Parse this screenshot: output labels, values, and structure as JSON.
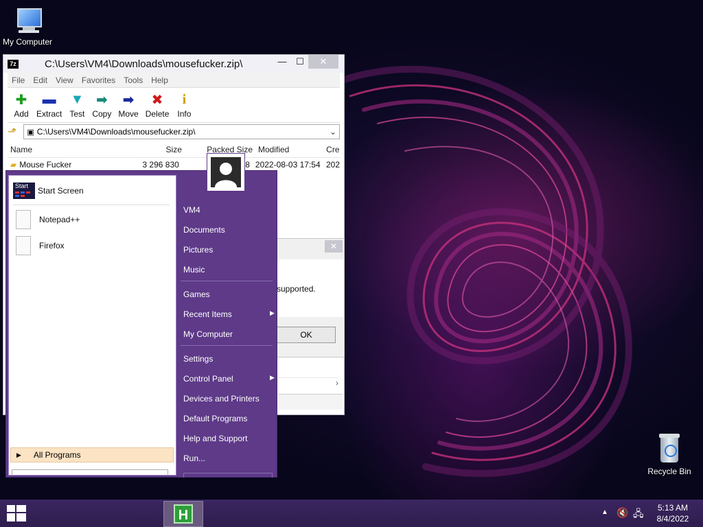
{
  "desktop": {
    "my_computer_label": "My Computer",
    "recycle_bin_label": "Recycle Bin"
  },
  "sevenzip": {
    "app_icon_text": "7z",
    "title": "C:\\Users\\VM4\\Downloads\\mousefucker.zip\\",
    "menu": [
      "File",
      "Edit",
      "View",
      "Favorites",
      "Tools",
      "Help"
    ],
    "toolbar": [
      {
        "label": "Add",
        "icon": "plus-icon",
        "color": "#1a9e1a",
        "glyph": "✚"
      },
      {
        "label": "Extract",
        "icon": "minus-icon",
        "color": "#1a30b0",
        "glyph": "▬"
      },
      {
        "label": "Test",
        "icon": "check-chevron-icon",
        "color": "#1aa8b8",
        "glyph": "✔"
      },
      {
        "label": "Copy",
        "icon": "arrow-right-icon",
        "color": "#1a8a7a",
        "glyph": "➡"
      },
      {
        "label": "Move",
        "icon": "arrow-right-icon",
        "color": "#1a2a9a",
        "glyph": "➡"
      },
      {
        "label": "Delete",
        "icon": "x-icon",
        "color": "#d01818",
        "glyph": "✖"
      },
      {
        "label": "Info",
        "icon": "info-icon",
        "color": "#c8a000",
        "glyph": "i"
      }
    ],
    "address": "C:\\Users\\VM4\\Downloads\\mousefucker.zip\\",
    "columns": {
      "name": "Name",
      "size": "Size",
      "packed": "Packed Size",
      "modified": "Modified",
      "created": "Cre"
    },
    "rows": [
      {
        "name": "Mouse Fucker",
        "size": "3 296 830",
        "packed": "38",
        "modified": "2022-08-03 17:54",
        "created": "202"
      }
    ]
  },
  "dialog": {
    "message": "supported.",
    "ok_label": "OK"
  },
  "start_menu": {
    "pinned": [
      {
        "label": "Start Screen",
        "icon_text": "Start"
      },
      {
        "label": "Notepad++"
      },
      {
        "label": "Firefox"
      }
    ],
    "all_programs": "All Programs",
    "right_items": [
      {
        "label": "VM4",
        "arrow": false
      },
      {
        "label": "Documents",
        "arrow": false
      },
      {
        "label": "Pictures",
        "arrow": false
      },
      {
        "label": "Music",
        "arrow": false
      },
      {
        "label": "Games",
        "arrow": false
      },
      {
        "label": "Recent Items",
        "arrow": true
      },
      {
        "label": "My Computer",
        "arrow": false
      },
      {
        "label": "Settings",
        "arrow": false
      },
      {
        "label": "Control Panel",
        "arrow": true
      },
      {
        "label": "Devices and Printers",
        "arrow": false
      },
      {
        "label": "Default Programs",
        "arrow": false
      },
      {
        "label": "Help and Support",
        "arrow": false
      },
      {
        "label": "Run...",
        "arrow": false
      }
    ]
  },
  "taskbar": {
    "app_letter": "H",
    "time": "5:13 AM",
    "date": "8/4/2022"
  },
  "colors": {
    "start_menu_purple": "#5e3a88",
    "taskbar": "#3b2660",
    "all_programs_highlight": "#fbe3c4"
  }
}
